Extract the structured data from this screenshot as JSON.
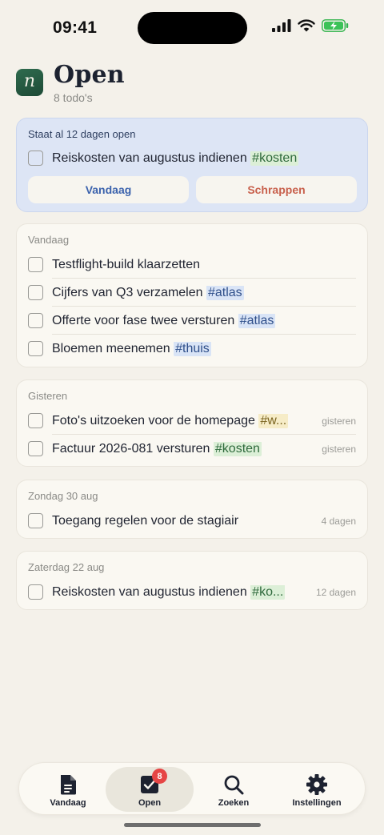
{
  "status_bar": {
    "time": "09:41"
  },
  "header": {
    "title": "Open",
    "subtitle": "8 todo's",
    "logo_letter": "n"
  },
  "stale_card": {
    "title": "Staat al 12 dagen open",
    "item": {
      "text": "Reiskosten van augustus indienen",
      "tag": "#kosten"
    },
    "buttons": {
      "today": "Vandaag",
      "discard": "Schrappen"
    }
  },
  "sections": [
    {
      "title": "Vandaag",
      "items": [
        {
          "text": "Testflight-build klaarzetten",
          "tag": "",
          "meta": ""
        },
        {
          "text": "Cijfers van Q3 verzamelen",
          "tag": "#atlas",
          "meta": ""
        },
        {
          "text": "Offerte voor fase twee versturen",
          "tag": "#atlas",
          "meta": ""
        },
        {
          "text": "Bloemen meenemen",
          "tag": "#thuis",
          "meta": ""
        }
      ]
    },
    {
      "title": "Gisteren",
      "items": [
        {
          "text": "Foto's uitzoeken voor de homepage",
          "tag": "#w...",
          "meta": "gisteren"
        },
        {
          "text": "Factuur 2026-081 versturen",
          "tag": "#kosten",
          "meta": "gisteren"
        }
      ]
    },
    {
      "title": "Zondag 30 aug",
      "items": [
        {
          "text": "Toegang regelen voor de stagiair",
          "tag": "",
          "meta": "4 dagen"
        }
      ]
    },
    {
      "title": "Zaterdag 22 aug",
      "items": [
        {
          "text": "Reiskosten van augustus indienen",
          "tag": "#ko...",
          "meta": "12 dagen"
        }
      ]
    }
  ],
  "tabbar": {
    "tabs": [
      {
        "label": "Vandaag",
        "icon": "document-icon"
      },
      {
        "label": "Open",
        "icon": "checkbox-icon",
        "badge": "8",
        "active": true
      },
      {
        "label": "Zoeken",
        "icon": "search-icon"
      },
      {
        "label": "Instellingen",
        "icon": "gear-icon"
      }
    ]
  },
  "colors": {
    "background": "#f4f1ea",
    "highlight_card": "#dde5f5",
    "accent_blue": "#3c63ad",
    "accent_red": "#c8604c",
    "badge": "#e64545",
    "logo_green": "#2f6b4e"
  }
}
